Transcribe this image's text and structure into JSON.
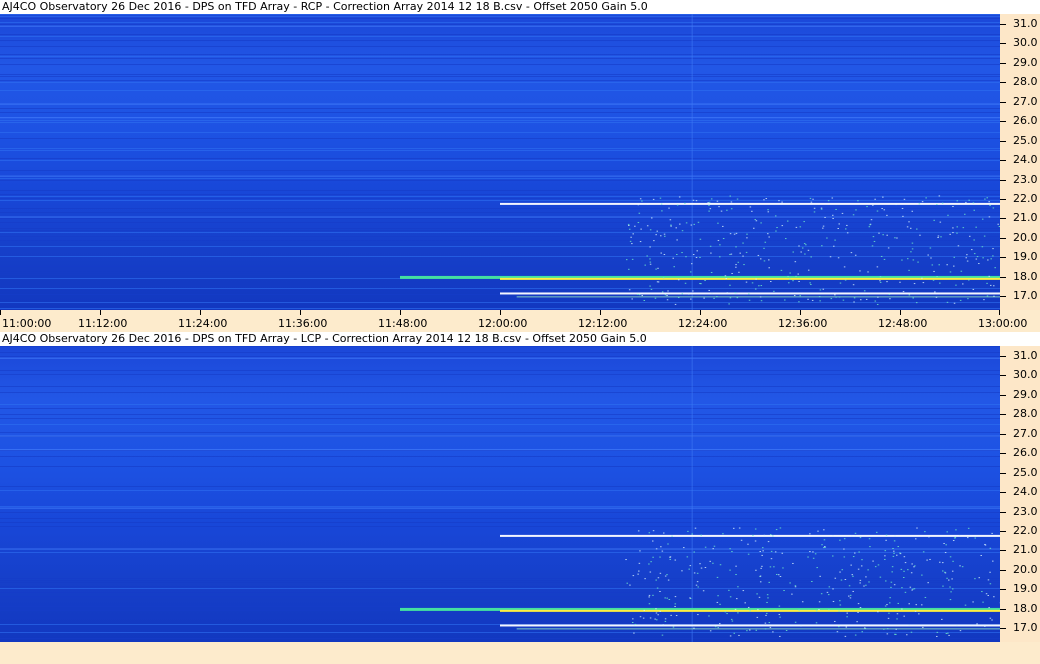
{
  "chart_data": [
    {
      "type": "heatmap",
      "title": "AJ4CO Observatory 26 Dec 2016  -  DPS on TFD Array  -  RCP  -  Correction Array 2014 12 18 B.csv  -  Offset 2050  Gain 5.0",
      "x_ticks": [
        "11:00:00",
        "11:12:00",
        "11:24:00",
        "11:36:00",
        "11:48:00",
        "12:00:00",
        "12:12:00",
        "12:24:00",
        "12:36:00",
        "12:48:00",
        "13:00:00"
      ],
      "y_ticks": [
        "31.0",
        "30.0",
        "29.0",
        "28.0",
        "27.0",
        "26.0",
        "25.0",
        "24.0",
        "23.0",
        "22.0",
        "21.0",
        "20.0",
        "19.0",
        "18.0",
        "17.0"
      ],
      "xlim": [
        "11:00:00",
        "13:00:00"
      ],
      "ylim": [
        16.3,
        31.5
      ],
      "colors": {
        "background": "#1d50e0",
        "low": "#1238c0",
        "high": "#ffffff",
        "mid": "#44e0a0",
        "hot": "#ffee40"
      }
    },
    {
      "type": "heatmap",
      "title": "AJ4CO Observatory 26 Dec 2016  -  DPS on TFD Array  -  LCP  -  Correction Array 2014 12 18 B.csv  -  Offset 2050  Gain 5.0",
      "y_ticks": [
        "31.0",
        "30.0",
        "29.0",
        "28.0",
        "27.0",
        "26.0",
        "25.0",
        "24.0",
        "23.0",
        "22.0",
        "21.0",
        "20.0",
        "19.0",
        "18.0",
        "17.0"
      ],
      "xlim": [
        "11:00:00",
        "13:00:00"
      ],
      "ylim": [
        16.3,
        31.5
      ],
      "colors": {
        "background": "#1d50e0",
        "low": "#1238c0",
        "high": "#ffffff",
        "mid": "#44e0a0",
        "hot": "#ffee40"
      }
    }
  ]
}
